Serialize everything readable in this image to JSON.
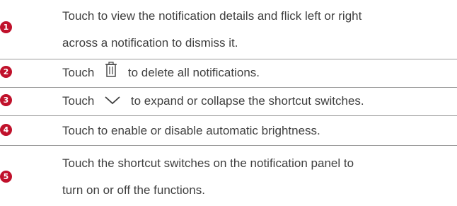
{
  "colors": {
    "badge": "#c0112b",
    "text": "#3f3f3f",
    "divider": "#9a9a9a"
  },
  "items": [
    {
      "number": "1",
      "line1": "Touch to view the notification details and flick left or right",
      "line2": "across a notification to dismiss it."
    },
    {
      "number": "2",
      "before": "Touch",
      "icon": "trash-icon",
      "after": "to delete all notifications."
    },
    {
      "number": "3",
      "before": "Touch",
      "icon": "chevron-down-icon",
      "after": "to expand or collapse the shortcut switches."
    },
    {
      "number": "4",
      "text": "Touch to enable or disable automatic brightness."
    },
    {
      "number": "5",
      "line1": "Touch the shortcut switches on the notification panel to",
      "line2": "turn on or off the functions."
    }
  ]
}
